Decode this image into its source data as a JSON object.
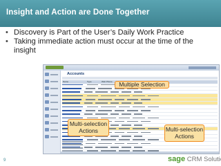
{
  "slide": {
    "title": "Insight and Action are Done Together",
    "bullets": [
      "Discovery is Part of the User’s Daily Work Practice",
      "Taking immediate action must occur at the time of the insight"
    ],
    "page_number": "9"
  },
  "screenshot": {
    "module_title": "Accounts",
    "columns": [
      "Name",
      "Type",
      "Web Phone",
      "City",
      "Owner",
      "Status"
    ],
    "navigation_icons": [
      "home-icon",
      "calendar-icon",
      "contacts-icon",
      "accounts-icon",
      "leads-icon",
      "opportunities-icon",
      "cases-icon",
      "reports-icon",
      "email-icon",
      "settings-icon"
    ]
  },
  "callouts": {
    "multiple_selection": "Multiple Selection",
    "multi_selection_actions_left": "Multi-selection Actions",
    "multi_selection_actions_right": "Multi-selection Actions"
  },
  "branding": {
    "logo_part1": "sage",
    "logo_part2": "CRM Solutions"
  },
  "colors": {
    "title_bar": "#4a90a0",
    "callout_border": "#f08a1d",
    "callout_fill": "#fae1a4",
    "selected_row": "#fbe79a",
    "sage_green": "#4e9a2e"
  }
}
